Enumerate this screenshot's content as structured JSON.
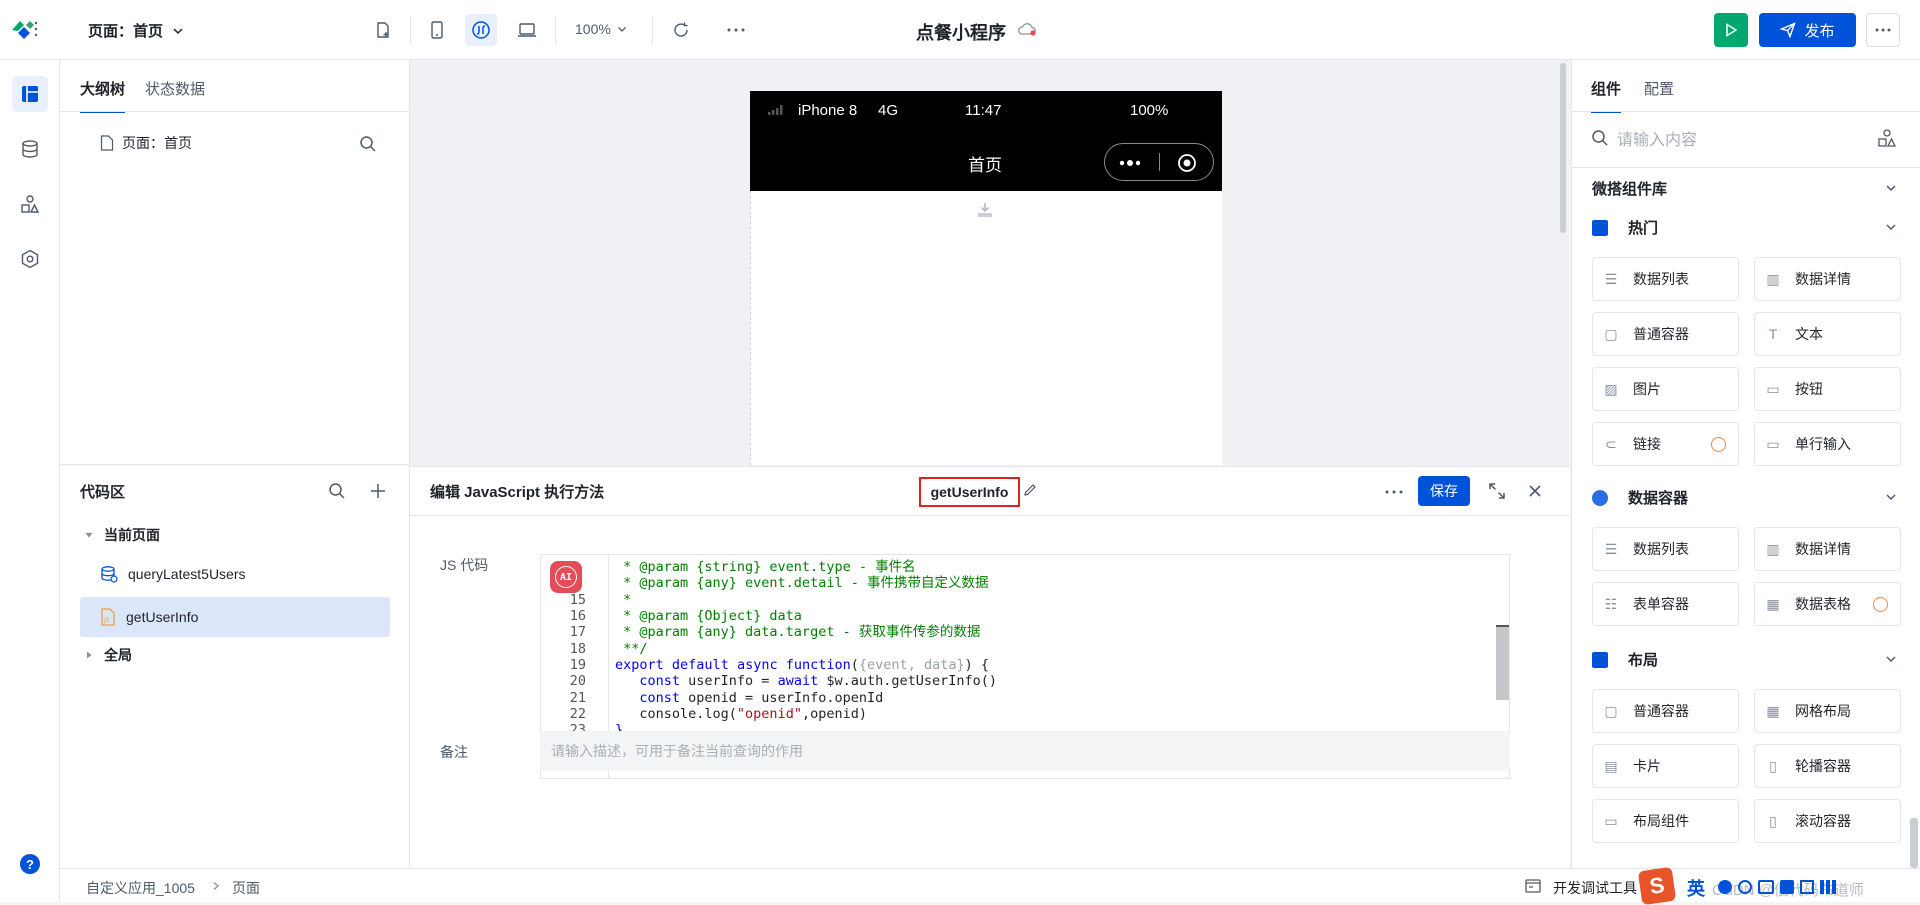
{
  "topbar": {
    "page_select": "页面：首页",
    "zoom": "100%",
    "app_title": "点餐小程序",
    "publish_label": "发布"
  },
  "outline": {
    "tabs": [
      "大纲树",
      "状态数据"
    ],
    "page_item": "页面：首页"
  },
  "code_area": {
    "title": "代码区",
    "current_page": "当前页面",
    "items": [
      "queryLatest5Users",
      "getUserInfo"
    ],
    "global": "全局"
  },
  "phone": {
    "carrier": "iPhone 8",
    "network": "4G",
    "time": "11:47",
    "battery": "100%",
    "page_title": "首页"
  },
  "editor": {
    "title": "编辑 JavaScript 执行方法",
    "method_name": "getUserInfo",
    "save_label": "保存",
    "js_label": "JS 代码",
    "ai_label": "AI",
    "note_label": "备注",
    "note_placeholder": "请输入描述，可用于备注当前查询的作用",
    "code_lines": [
      {
        "n": "",
        "t": " * @param {string} event.type - 事件名",
        "c": "cm"
      },
      {
        "n": "",
        "t": " * @param {any} event.detail - 事件携带自定义数据",
        "c": "cm"
      },
      {
        "n": "15",
        "t": " *",
        "c": "cm"
      },
      {
        "n": "16",
        "t": " * @param {Object} data",
        "c": "cm"
      },
      {
        "n": "17",
        "t": " * @param {any} data.target - 获取事件传参的数据",
        "c": "cm"
      },
      {
        "n": "18",
        "t": " **/",
        "c": "cm"
      },
      {
        "n": "19",
        "t": "export default async function({event, data}) {",
        "c": "mix19"
      },
      {
        "n": "20",
        "t": "   const userInfo = await $w.auth.getUserInfo()",
        "c": "mix20"
      },
      {
        "n": "21",
        "t": "   const openid = userInfo.openId",
        "c": "mix21"
      },
      {
        "n": "22",
        "t": "   console.log(\"openid\",openid)",
        "c": "mix22"
      },
      {
        "n": "23",
        "t": "}",
        "c": "kw"
      }
    ]
  },
  "right_panel": {
    "tabs": [
      "组件",
      "配置"
    ],
    "search_placeholder": "请输入内容",
    "library_title": "微搭组件库",
    "sections": [
      {
        "title": "热门",
        "items": [
          "数据列表",
          "数据详情",
          "普通容器",
          "文本",
          "图片",
          "按钮",
          "链接",
          "单行输入"
        ]
      },
      {
        "title": "数据容器",
        "items": [
          "数据列表",
          "数据详情",
          "表单容器",
          "数据表格"
        ]
      },
      {
        "title": "布局",
        "items": [
          "普通容器",
          "网格布局",
          "卡片",
          "轮播容器",
          "布局组件",
          "滚动容器"
        ]
      }
    ]
  },
  "bottombar": {
    "breadcrumb": [
      "自定义应用_1005",
      "页面"
    ],
    "devtools": "开发调试工具",
    "ime": "英",
    "watermark": "CSDN @低代码布道师"
  },
  "colors": {
    "accent": "#0052d9",
    "run_green": "#00a870",
    "highlight_red": "#e34d59"
  }
}
